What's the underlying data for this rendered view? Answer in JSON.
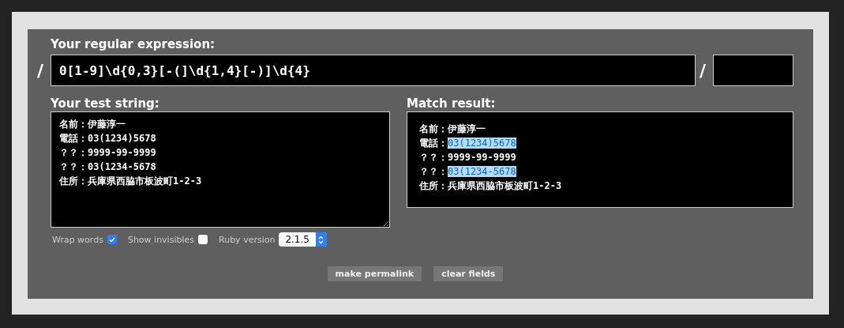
{
  "regex": {
    "label": "Your regular expression:",
    "delimiter_open": "/",
    "value": "0[1-9]\\d{0,3}[-(]\\d{1,4}[-)]\\d{4}",
    "delimiter_close": "/"
  },
  "test_string": {
    "label": "Your test string:",
    "lines": [
      "名前：伊藤淳一",
      "電話：03(1234)5678",
      "？？：9999-99-9999",
      "？？：03(1234-5678",
      "住所：兵庫県西脇市板波町1-2-3"
    ]
  },
  "options": [
    {
      "kind": "checkbox",
      "label": "Wrap words",
      "checked": true
    },
    {
      "kind": "checkbox",
      "label": "Show invisibles",
      "checked": false
    },
    {
      "kind": "select",
      "label": "Ruby version",
      "value": "2.1.5"
    }
  ],
  "match_result": {
    "label": "Match result:",
    "lines": [
      {
        "segments": [
          {
            "text": "名前：伊藤淳一",
            "match": false
          }
        ]
      },
      {
        "segments": [
          {
            "text": "電話：",
            "match": false
          },
          {
            "text": "03(1234)5678",
            "match": true
          }
        ]
      },
      {
        "segments": [
          {
            "text": "？？：9999-99-9999",
            "match": false
          }
        ]
      },
      {
        "segments": [
          {
            "text": "？？：",
            "match": false
          },
          {
            "text": "03(1234-5678",
            "match": true
          }
        ]
      },
      {
        "segments": [
          {
            "text": "住所：兵庫県西脇市板波町1-2-3",
            "match": false
          }
        ]
      }
    ]
  },
  "buttons": [
    "make permalink",
    "clear fields"
  ]
}
